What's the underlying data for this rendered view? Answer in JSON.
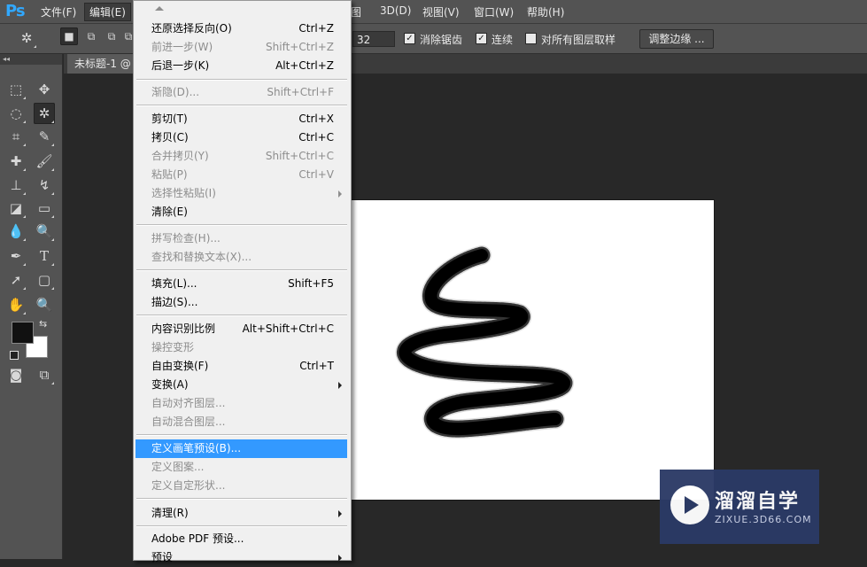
{
  "app": {
    "logo": "Ps"
  },
  "menubar": {
    "items": [
      {
        "label": "文件(F)"
      },
      {
        "label": "编辑(E)"
      },
      {
        "label": "图"
      },
      {
        "label": "3D(D)"
      },
      {
        "label": "视图(V)"
      },
      {
        "label": "窗口(W)"
      },
      {
        "label": "帮助(H)"
      }
    ]
  },
  "options": {
    "tolerance_value": "32",
    "antialias_label": "消除锯齿",
    "antialias_checked": true,
    "contiguous_label": "连续",
    "contiguous_checked": true,
    "sample_all_label": "对所有图层取样",
    "sample_all_checked": false,
    "refine_edge_label": "调整边缘 ..."
  },
  "document": {
    "tab_title": "未标题-1 @"
  },
  "edit_menu": {
    "items": [
      {
        "label": "还原选择反向(O)",
        "shortcut": "Ctrl+Z",
        "disabled": false
      },
      {
        "label": "前进一步(W)",
        "shortcut": "Shift+Ctrl+Z",
        "disabled": true
      },
      {
        "label": "后退一步(K)",
        "shortcut": "Alt+Ctrl+Z",
        "disabled": false
      },
      {
        "label": "渐隐(D)...",
        "shortcut": "Shift+Ctrl+F",
        "disabled": true
      },
      {
        "label": "剪切(T)",
        "shortcut": "Ctrl+X",
        "disabled": false
      },
      {
        "label": "拷贝(C)",
        "shortcut": "Ctrl+C",
        "disabled": false
      },
      {
        "label": "合并拷贝(Y)",
        "shortcut": "Shift+Ctrl+C",
        "disabled": true
      },
      {
        "label": "粘贴(P)",
        "shortcut": "Ctrl+V",
        "disabled": true
      },
      {
        "label": "选择性粘贴(I)",
        "shortcut": "",
        "disabled": true,
        "submenu": true
      },
      {
        "label": "清除(E)",
        "shortcut": "",
        "disabled": false
      },
      {
        "label": "拼写检查(H)...",
        "shortcut": "",
        "disabled": true
      },
      {
        "label": "查找和替换文本(X)...",
        "shortcut": "",
        "disabled": true
      },
      {
        "label": "填充(L)...",
        "shortcut": "Shift+F5",
        "disabled": false
      },
      {
        "label": "描边(S)...",
        "shortcut": "",
        "disabled": false
      },
      {
        "label": "内容识别比例",
        "shortcut": "Alt+Shift+Ctrl+C",
        "disabled": false
      },
      {
        "label": "操控变形",
        "shortcut": "",
        "disabled": true
      },
      {
        "label": "自由变换(F)",
        "shortcut": "Ctrl+T",
        "disabled": false
      },
      {
        "label": "变换(A)",
        "shortcut": "",
        "disabled": false,
        "submenu": true
      },
      {
        "label": "自动对齐图层...",
        "shortcut": "",
        "disabled": true
      },
      {
        "label": "自动混合图层...",
        "shortcut": "",
        "disabled": true
      },
      {
        "label": "定义画笔预设(B)...",
        "shortcut": "",
        "disabled": false,
        "highlighted": true
      },
      {
        "label": "定义图案...",
        "shortcut": "",
        "disabled": true
      },
      {
        "label": "定义自定形状...",
        "shortcut": "",
        "disabled": true
      },
      {
        "label": "清理(R)",
        "shortcut": "",
        "disabled": false,
        "submenu": true
      },
      {
        "label": "Adobe PDF 预设...",
        "shortcut": "",
        "disabled": false
      },
      {
        "label": "预设",
        "shortcut": "",
        "disabled": false,
        "submenu": true
      }
    ]
  },
  "colors": {
    "foreground": "#111111",
    "background": "#ffffff",
    "highlight": "#3399ff"
  },
  "watermark": {
    "title": "溜溜自学",
    "subtitle": "ZIXUE.3D66.COM"
  }
}
